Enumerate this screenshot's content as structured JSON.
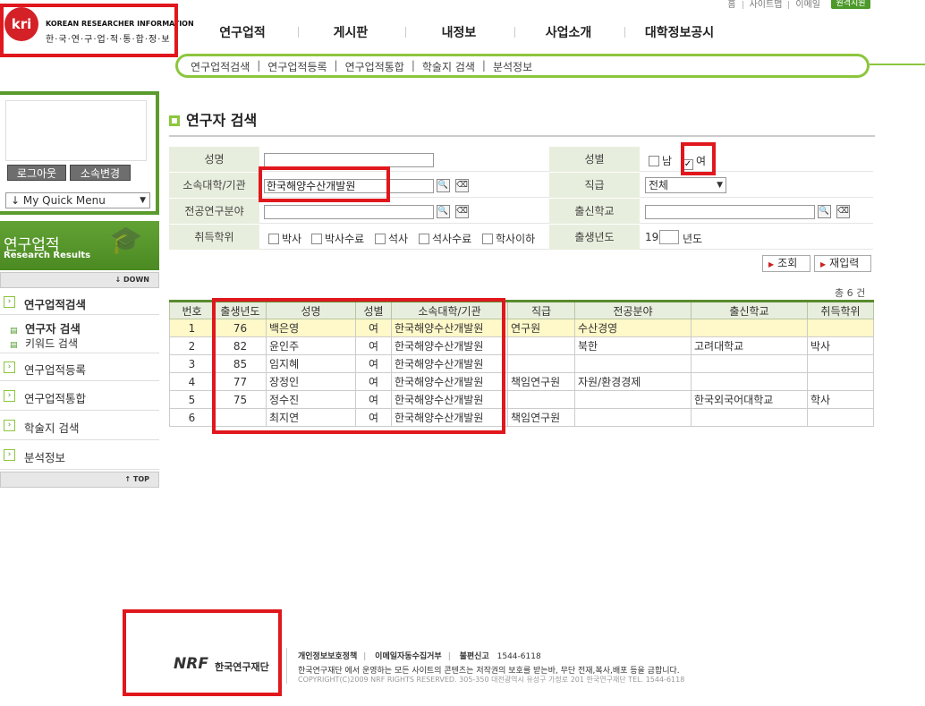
{
  "util": {
    "links": [
      "홈",
      "사이트맵",
      "이메일"
    ],
    "green_btn": "원격지원"
  },
  "logo": {
    "mark": "kri",
    "title": "KOREAN RESEARCHER INFORMATION",
    "subtitle": "한·국·연·구·업·적·통·합·정·보"
  },
  "nav": {
    "items": [
      "연구업적",
      "게시판",
      "내정보",
      "사업소개",
      "대학정보공시"
    ]
  },
  "subnav": {
    "items": [
      "연구업적검색",
      "연구업적등록",
      "연구업적통합",
      "학술지 검색",
      "분석정보"
    ]
  },
  "sidebar": {
    "logout": "로그아웃",
    "change_org": "소속변경",
    "quick_menu": "↓ My Quick Menu",
    "banner_title": "연구업적",
    "banner_sub": "Research Results",
    "down": "↓ DOWN",
    "top": "↑ TOP",
    "menu": [
      "연구업적검색",
      "연구업적등록",
      "연구업적통합",
      "학술지 검색",
      "분석정보"
    ],
    "submenu": [
      "연구자 검색",
      "키워드 검색"
    ]
  },
  "page": {
    "title": "연구자 검색"
  },
  "form": {
    "name_label": "성명",
    "name_value": "",
    "gender_label": "성별",
    "gender_male": "남",
    "gender_female": "여",
    "female_checked": "✓",
    "org_label": "소속대학/기관",
    "org_value": "한국해양수산개발원",
    "position_label": "직급",
    "position_value": "전체",
    "field_label": "전공연구분야",
    "school_label": "출신학교",
    "degree_label": "취득학위",
    "degrees": [
      "박사",
      "박사수료",
      "석사",
      "석사수료",
      "학사이하"
    ],
    "birth_label": "출생년도",
    "birth_prefix": "19",
    "birth_suffix": "년도"
  },
  "buttons": {
    "search": "조회",
    "reset": "재입력"
  },
  "count": "총 6 건",
  "table": {
    "headers": [
      "번호",
      "출생년도",
      "성명",
      "성별",
      "소속대학/기관",
      "직급",
      "전공분야",
      "출신학교",
      "취득학위"
    ],
    "rows": [
      [
        "1",
        "76",
        "백은영",
        "여",
        "한국해양수산개발원",
        "연구원",
        "수산경영",
        "",
        ""
      ],
      [
        "2",
        "82",
        "윤인주",
        "여",
        "한국해양수산개발원",
        "",
        "북한",
        "고려대학교",
        "박사"
      ],
      [
        "3",
        "85",
        "임지혜",
        "여",
        "한국해양수산개발원",
        "",
        "",
        "",
        ""
      ],
      [
        "4",
        "77",
        "장정인",
        "여",
        "한국해양수산개발원",
        "책임연구원",
        "자원/환경경제",
        "",
        ""
      ],
      [
        "5",
        "75",
        "정수진",
        "여",
        "한국해양수산개발원",
        "",
        "",
        "한국외국어대학교",
        "학사"
      ],
      [
        "6",
        "",
        "최지연",
        "여",
        "한국해양수산개발원",
        "책임연구원",
        "",
        "",
        ""
      ]
    ]
  },
  "footer": {
    "nrf": "NRF",
    "nrf_name": "한국연구재단",
    "links": [
      "개인정보보호정책",
      "이메일자동수집거부",
      "불편신고"
    ],
    "phone": "1544-6118",
    "copy1": "한국연구재단 에서 운영하는 모든 사이트의 콘텐츠는 저작권의 보호를 받는바, 무단 전재,복사,배포 등을 금합니다.",
    "copy2": "COPYRIGHT(C)2009 NRF RIGHTS RESERVED.  305-350 대전광역시 유성구 가정로 201 한국연구재단  TEL. 1544-6118"
  },
  "colors": {
    "accent_green": "#8cc63e",
    "dark_green": "#5a9b2d",
    "highlight_red": "#e0171d",
    "row_highlight": "#fff8c8"
  }
}
